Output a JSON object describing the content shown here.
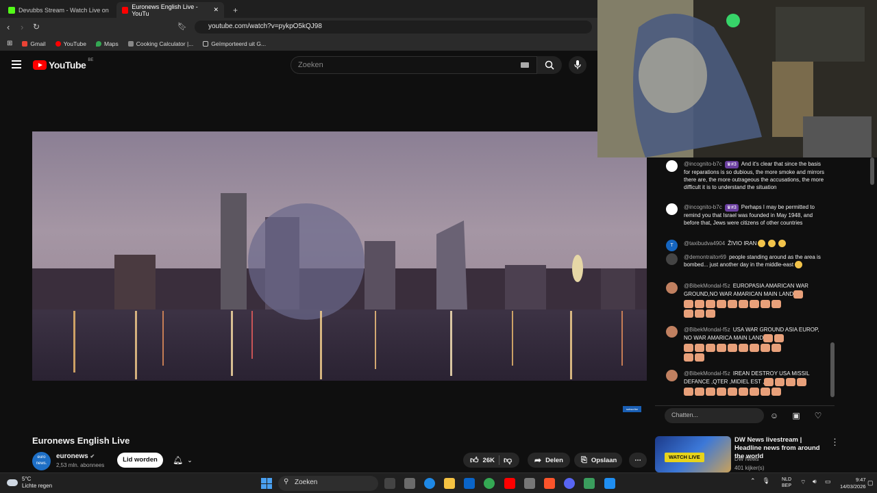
{
  "browser": {
    "tabs": [
      {
        "label": "Devubbs Stream - Watch Live on",
        "icon": "kick-icon",
        "color": "#53fc18"
      },
      {
        "label": "Euronews English Live - YouTu",
        "icon": "youtube-icon",
        "color": "#ff0000"
      }
    ],
    "new_tab": "+",
    "close_tab": "✕",
    "url": "youtube.com/watch?v=pykpO5kQJ98",
    "bookmarks": [
      {
        "label": "Gmail",
        "color": "#ea4335"
      },
      {
        "label": "YouTube",
        "color": "#ff0000"
      },
      {
        "label": "Maps",
        "color": "#34a853"
      },
      {
        "label": "Cooking Calculator |...",
        "color": "#888888"
      },
      {
        "label": "Geïmporteerd uit G...",
        "color": "#c8c8c8"
      }
    ]
  },
  "youtube": {
    "logo": "YouTube",
    "country": "BE",
    "search_placeholder": "Zoeken"
  },
  "video": {
    "title": "Euronews English Live",
    "overlay_badge": "subscribe",
    "channel": {
      "name": "euronews",
      "avatar_text": "euro news.",
      "subscribers": "2,53 mln. abonnees",
      "join_label": "Lid worden",
      "verified": "✔"
    },
    "actions": {
      "likes": "26K",
      "share": "Delen",
      "save": "Opslaan",
      "more": "⋯"
    }
  },
  "chat": {
    "messages": [
      {
        "author": "@incognito-b7c",
        "badge": "♛#3",
        "text": "And it's clear that since the basis for reparations is so dubious, the more smoke and mirrors there are, the more outrageous the accusations, the more difficult it is to understand the situation",
        "avatar_color": "#ffffff"
      },
      {
        "author": "@incognito-b7c",
        "badge": "♛#3",
        "text": "Perhaps I may be permitted to remind you that Israel was founded in May 1948, and before that, Jews were citizens of other countries",
        "avatar_color": "#ffffff"
      },
      {
        "author": "@taxibudva4904",
        "badge": "",
        "text": "ŽIVIO IRAN",
        "avatar_color": "#1565c0",
        "avatar_text": "T"
      },
      {
        "author": "@demontraitor69",
        "badge": "",
        "text": "people standing around as the area is bombed... just another day in the middle-east",
        "avatar_color": "#444444"
      },
      {
        "author": "@BibekMondal-f5z",
        "badge": "",
        "text": "EUROPASIA AMARICAN WAR GROUND,NO WAR AMARICAN MAIN LAND",
        "avatar_color": "#c08060"
      },
      {
        "author": "@BibekMondal-f5z",
        "badge": "",
        "text": "USA WAR GROUND ASIA EUROP, NO WAR AMARICA MAIN LAND",
        "avatar_color": "#c08060"
      },
      {
        "author": "@BibekMondal-f5z",
        "badge": "",
        "text": "IREAN DESTROY USA MISSIL DEFANCE ,QTER ,MIDIEL EST ,",
        "avatar_color": "#c08060"
      }
    ],
    "input_placeholder": "Chatten..."
  },
  "recommended": {
    "title": "DW News livestream | Headline news from around the world",
    "channel": "DW News",
    "views": "401 kijker(s)",
    "badge": "WATCH LIVE"
  },
  "taskbar": {
    "temperature": "5°C",
    "weather": "Lichte regen",
    "search_label": "Zoeken",
    "lang_top": "NLD",
    "lang_bottom": "BEP",
    "time": "9:47",
    "date": "14/03/2026"
  }
}
